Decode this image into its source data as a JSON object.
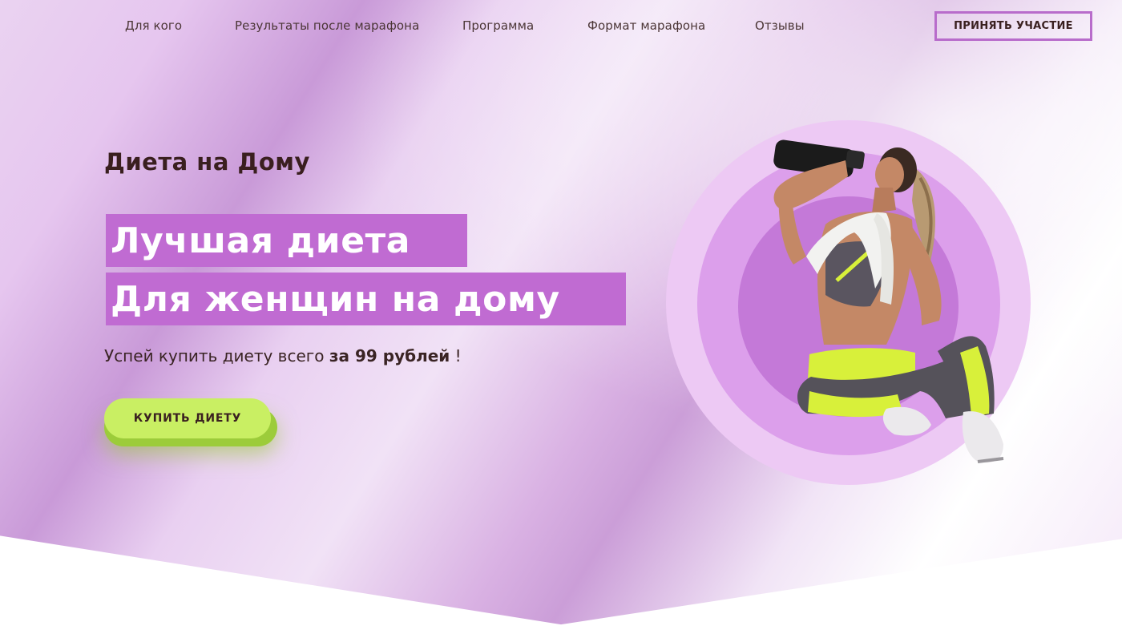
{
  "nav": {
    "items": [
      {
        "label": "Для кого"
      },
      {
        "label": "Результаты после марафона"
      },
      {
        "label": "Программа"
      },
      {
        "label": "Формат марафона"
      },
      {
        "label": "Отзывы"
      }
    ],
    "cta_label": "ПРИНЯТЬ УЧАСТИЕ"
  },
  "hero": {
    "brand": "Диета на Дому",
    "headline_line1": "Лучшая диета",
    "headline_line2": "Для женщин на дому",
    "offer_prefix": "Успей купить диету всего ",
    "offer_price": "за 99 рублей",
    "offer_suffix": " !",
    "buy_label": "КУПИТЬ ДИЕТУ"
  },
  "colors": {
    "accent_purple": "#c06bd2",
    "button_lime": "#c9ef63",
    "text_dark": "#3a1f1f"
  },
  "illustration": {
    "subject": "woman-drinking-from-shaker-icon"
  }
}
